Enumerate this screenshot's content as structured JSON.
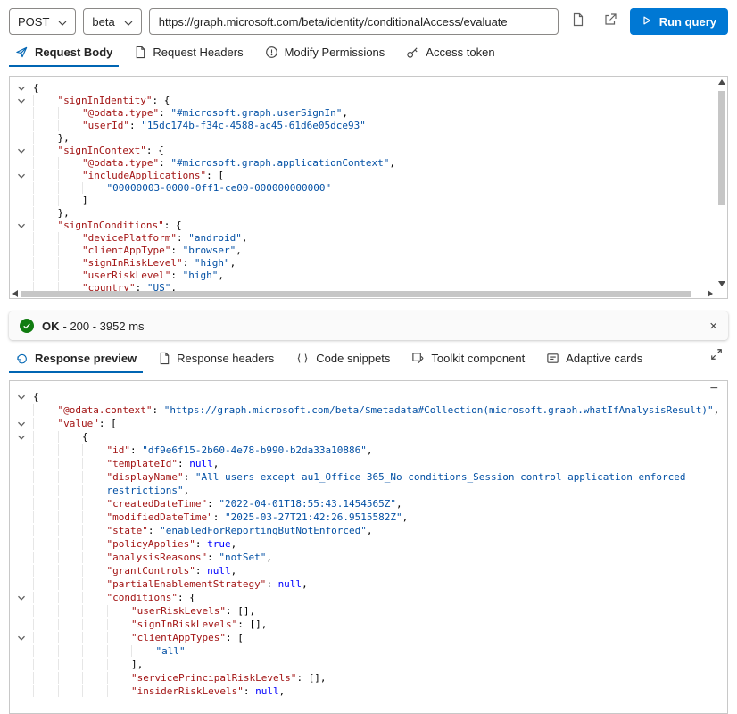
{
  "colors": {
    "accent": "#0078d4",
    "active_tab_underline": "#0065b3",
    "success_green": "#107c10",
    "json_key": "#a31515",
    "json_string": "#0451a5",
    "json_keyword": "#0000ff"
  },
  "icons": {
    "close": "×",
    "collapse": "−"
  },
  "query_bar": {
    "method": "POST",
    "version": "beta",
    "url": "https://graph.microsoft.com/beta/identity/conditionalAccess/evaluate",
    "run_label": "Run query"
  },
  "request_tabs": [
    {
      "label": "Request Body",
      "icon": "send-icon",
      "active": true
    },
    {
      "label": "Request Headers",
      "icon": "document-icon",
      "active": false
    },
    {
      "label": "Modify Permissions",
      "icon": "permissions-icon",
      "active": false
    },
    {
      "label": "Access token",
      "icon": "key-icon",
      "active": false
    }
  ],
  "status_bar": {
    "status": "OK",
    "detail": "- 200 - 3952 ms"
  },
  "response_tabs": [
    {
      "label": "Response preview",
      "icon": "preview-icon",
      "active": true
    },
    {
      "label": "Response headers",
      "icon": "headers-icon",
      "active": false
    },
    {
      "label": "Code snippets",
      "icon": "code-snippets-icon",
      "active": false
    },
    {
      "label": "Toolkit component",
      "icon": "toolkit-icon",
      "active": false
    },
    {
      "label": "Adaptive cards",
      "icon": "adaptive-cards-icon",
      "active": false
    }
  ],
  "request_editor": {
    "lines": [
      {
        "fold": true,
        "ind": 0,
        "text": "{"
      },
      {
        "fold": true,
        "ind": 1,
        "text": "\"signInIdentity\": {"
      },
      {
        "ind": 2,
        "text": "\"@odata.type\": \"#microsoft.graph.userSignIn\","
      },
      {
        "ind": 2,
        "text": "\"userId\": \"15dc174b-f34c-4588-ac45-61d6e05dce93\""
      },
      {
        "ind": 1,
        "text": "},"
      },
      {
        "fold": true,
        "ind": 1,
        "text": "\"signInContext\": {"
      },
      {
        "ind": 2,
        "text": "\"@odata.type\": \"#microsoft.graph.applicationContext\","
      },
      {
        "fold": true,
        "ind": 2,
        "text": "\"includeApplications\": ["
      },
      {
        "ind": 3,
        "text": "\"00000003-0000-0ff1-ce00-000000000000\""
      },
      {
        "ind": 2,
        "text": "]"
      },
      {
        "ind": 1,
        "text": "},"
      },
      {
        "fold": true,
        "ind": 1,
        "text": "\"signInConditions\": {"
      },
      {
        "ind": 2,
        "text": "\"devicePlatform\": \"android\","
      },
      {
        "ind": 2,
        "text": "\"clientAppType\": \"browser\","
      },
      {
        "ind": 2,
        "text": "\"signInRiskLevel\": \"high\","
      },
      {
        "ind": 2,
        "text": "\"userRiskLevel\": \"high\","
      },
      {
        "ind": 2,
        "text": "\"country\": \"US\","
      }
    ]
  },
  "response_editor": {
    "lines": [
      {
        "fold": true,
        "ind": 0,
        "text": "{"
      },
      {
        "ind": 1,
        "text": "\"@odata.context\": \"https://graph.microsoft.com/beta/$metadata#Collection(microsoft.graph.whatIfAnalysisResult)\","
      },
      {
        "fold": true,
        "ind": 1,
        "text": "\"value\": ["
      },
      {
        "fold": true,
        "ind": 2,
        "text": "{"
      },
      {
        "ind": 3,
        "text": "\"id\": \"df9e6f15-2b60-4e78-b990-b2da33a10886\","
      },
      {
        "ind": 3,
        "text": "\"templateId\": null,"
      },
      {
        "ind": 3,
        "mode": "open",
        "text": "\"displayName\": \"All users except au1_Office 365_No conditions_Session control application enforced"
      },
      {
        "ind": 3,
        "mode": "cont",
        "text": "restrictions\","
      },
      {
        "ind": 3,
        "text": "\"createdDateTime\": \"2022-04-01T18:55:43.1454565Z\","
      },
      {
        "ind": 3,
        "text": "\"modifiedDateTime\": \"2025-03-27T21:42:26.9515582Z\","
      },
      {
        "ind": 3,
        "text": "\"state\": \"enabledForReportingButNotEnforced\","
      },
      {
        "ind": 3,
        "text": "\"policyApplies\": true,"
      },
      {
        "ind": 3,
        "text": "\"analysisReasons\": \"notSet\","
      },
      {
        "ind": 3,
        "text": "\"grantControls\": null,"
      },
      {
        "ind": 3,
        "text": "\"partialEnablementStrategy\": null,"
      },
      {
        "fold": true,
        "ind": 3,
        "text": "\"conditions\": {"
      },
      {
        "ind": 4,
        "text": "\"userRiskLevels\": [],"
      },
      {
        "ind": 4,
        "text": "\"signInRiskLevels\": [],"
      },
      {
        "fold": true,
        "ind": 4,
        "text": "\"clientAppTypes\": ["
      },
      {
        "ind": 5,
        "text": "\"all\""
      },
      {
        "ind": 4,
        "text": "],"
      },
      {
        "ind": 4,
        "text": "\"servicePrincipalRiskLevels\": [],"
      },
      {
        "ind": 4,
        "text": "\"insiderRiskLevels\": null,"
      }
    ]
  }
}
